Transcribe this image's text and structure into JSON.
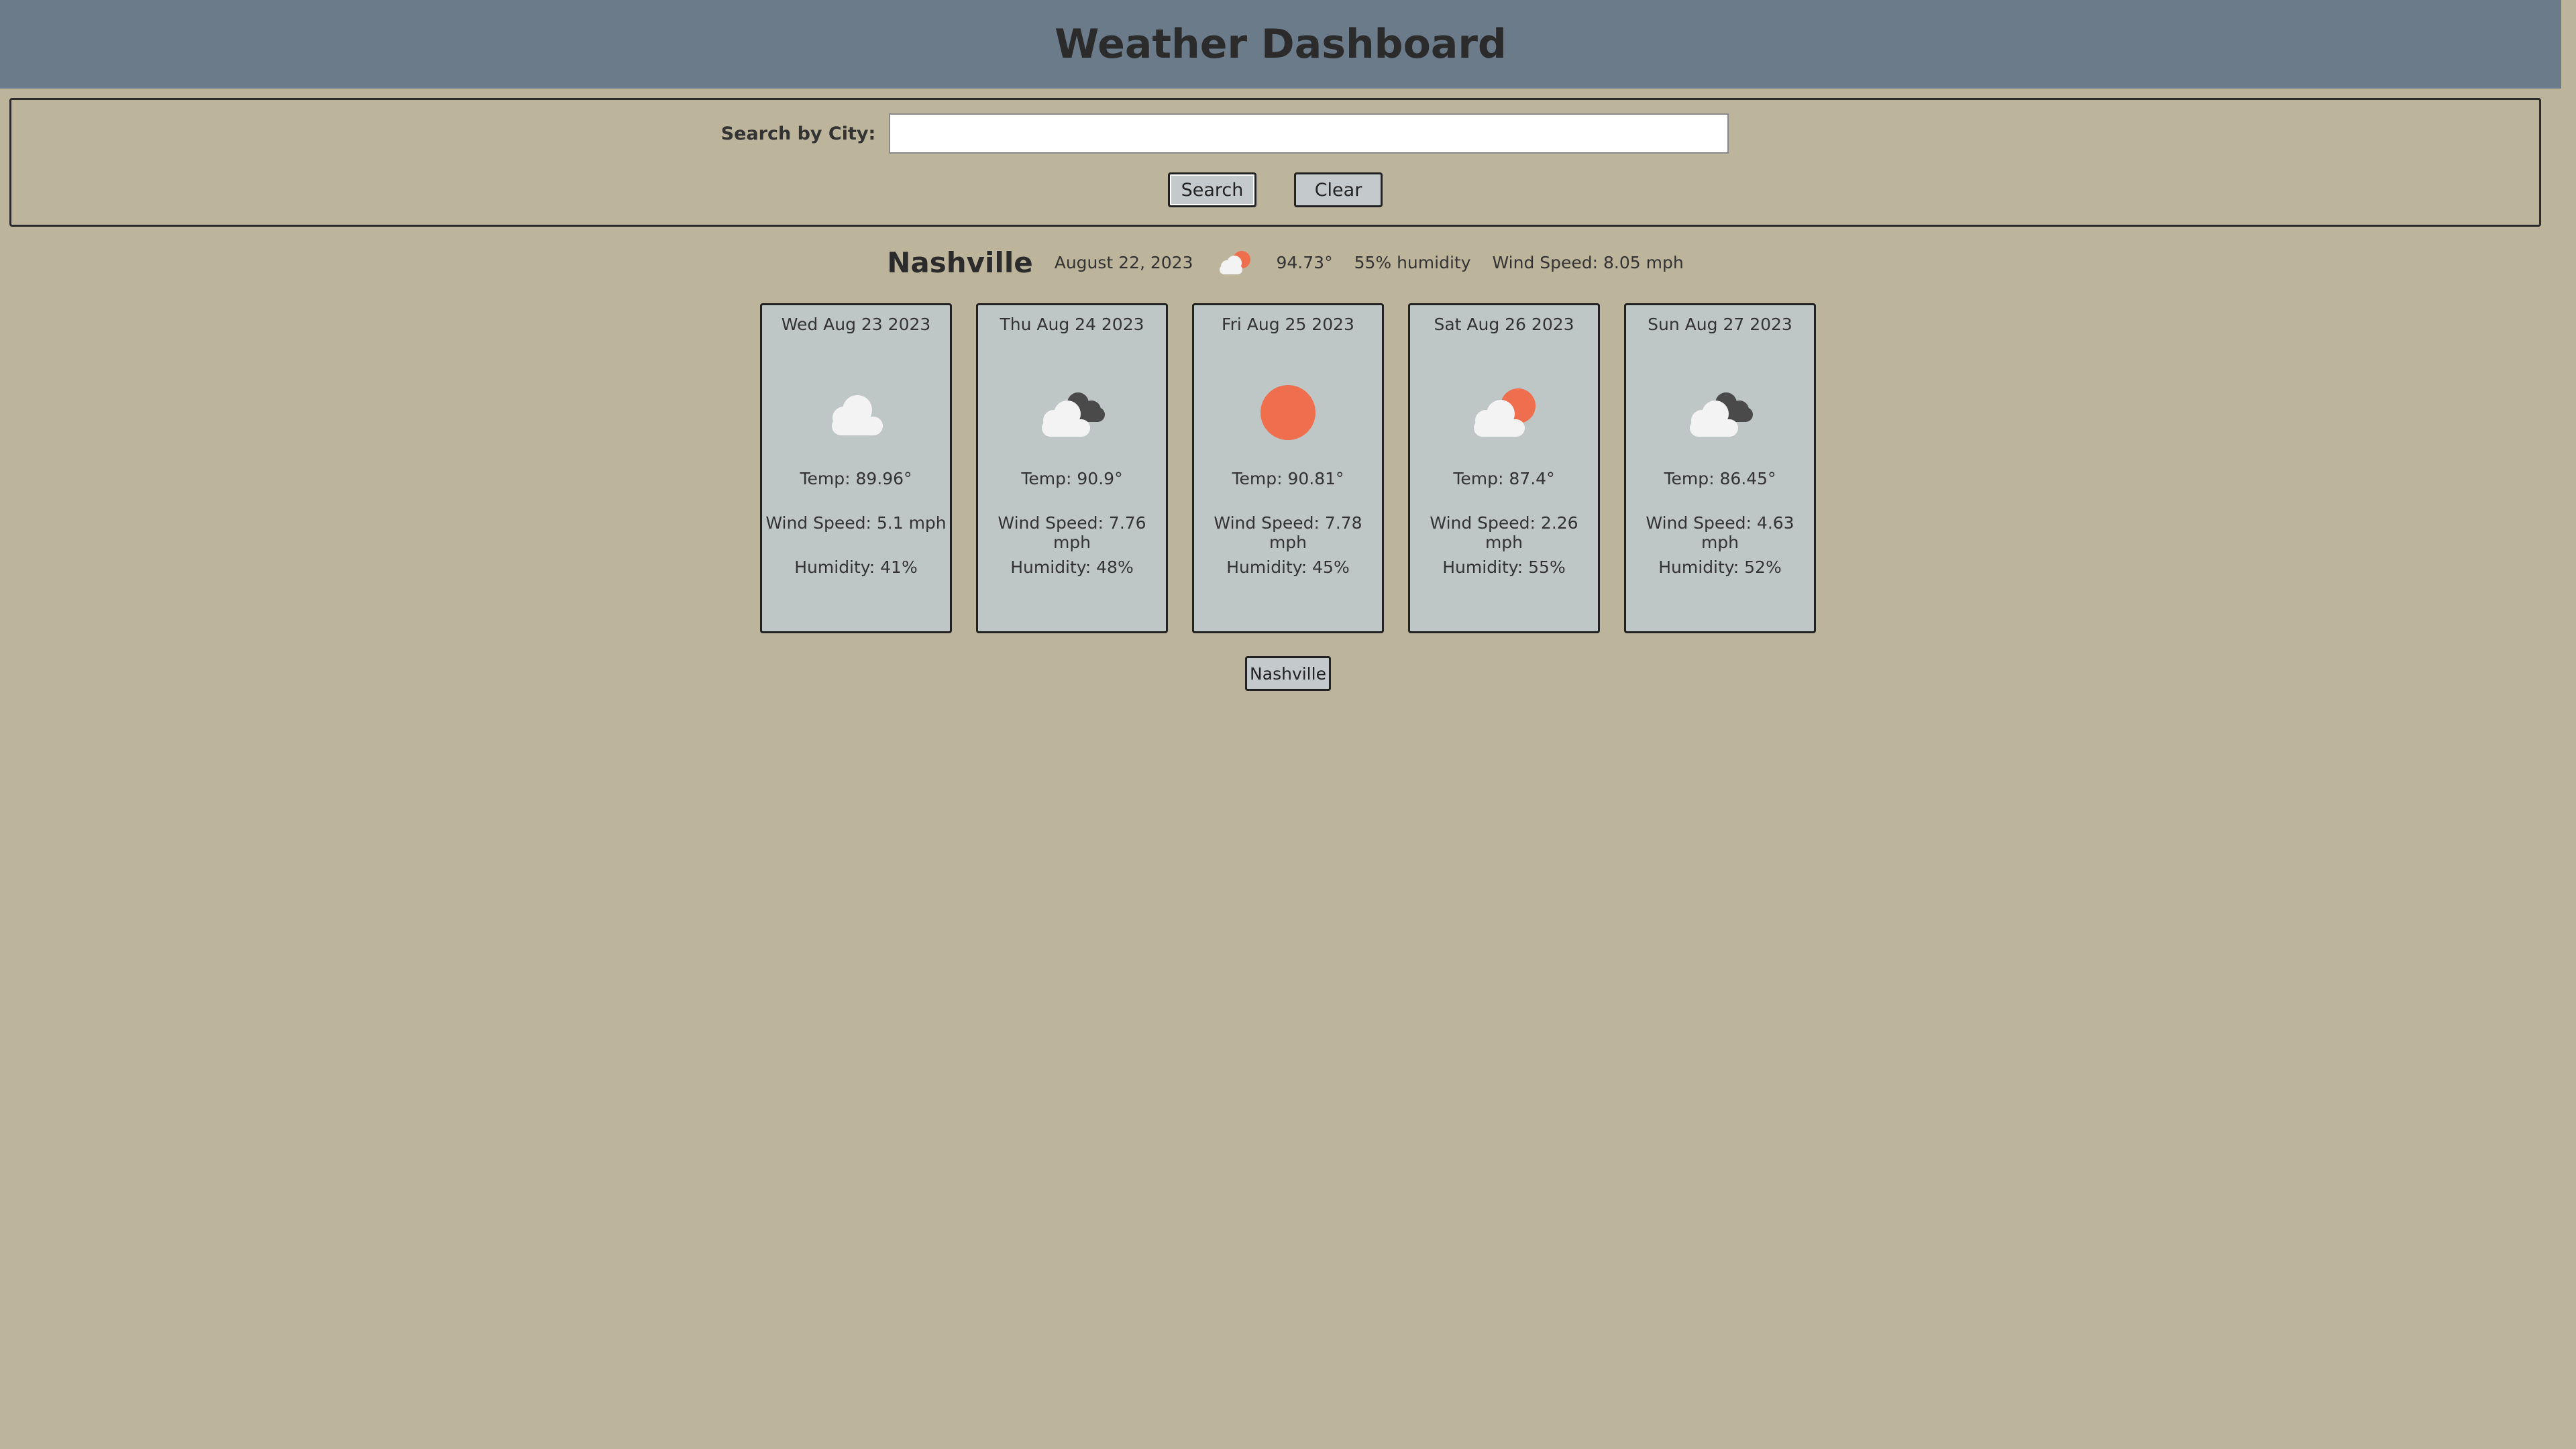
{
  "header": {
    "title": "Weather Dashboard"
  },
  "search": {
    "label": "Search by City:",
    "value": "",
    "placeholder": "",
    "search_button": "Search",
    "clear_button": "Clear"
  },
  "current": {
    "city": "Nashville",
    "date": "August 22, 2023",
    "icon": "partly-cloudy-sun-icon",
    "temp": "94.73°",
    "humidity": "55% humidity",
    "wind": "Wind Speed: 8.05 mph"
  },
  "forecast": [
    {
      "date": "Wed Aug 23 2023",
      "icon": "cloud-icon",
      "temp": "Temp: 89.96°",
      "wind": "Wind Speed: 5.1 mph",
      "humidity": "Humidity: 41%"
    },
    {
      "date": "Thu Aug 24 2023",
      "icon": "broken-clouds-icon",
      "temp": "Temp: 90.9°",
      "wind": "Wind Speed: 7.76 mph",
      "humidity": "Humidity: 48%"
    },
    {
      "date": "Fri Aug 25 2023",
      "icon": "sun-icon",
      "temp": "Temp: 90.81°",
      "wind": "Wind Speed: 7.78 mph",
      "humidity": "Humidity: 45%"
    },
    {
      "date": "Sat Aug 26 2023",
      "icon": "partly-cloudy-sun-icon",
      "temp": "Temp: 87.4°",
      "wind": "Wind Speed: 2.26 mph",
      "humidity": "Humidity: 55%"
    },
    {
      "date": "Sun Aug 27 2023",
      "icon": "broken-clouds-icon",
      "temp": "Temp: 86.45°",
      "wind": "Wind Speed: 4.63 mph",
      "humidity": "Humidity: 52%"
    }
  ],
  "history": [
    "Nashville"
  ],
  "colors": {
    "header_bg": "#6b7b8a",
    "page_bg": "#bdb49c",
    "card_bg": "#bfc6c6",
    "sun": "#ee6e4e",
    "dark_cloud": "#4a4a4a",
    "light_cloud": "#f3f3f3"
  }
}
